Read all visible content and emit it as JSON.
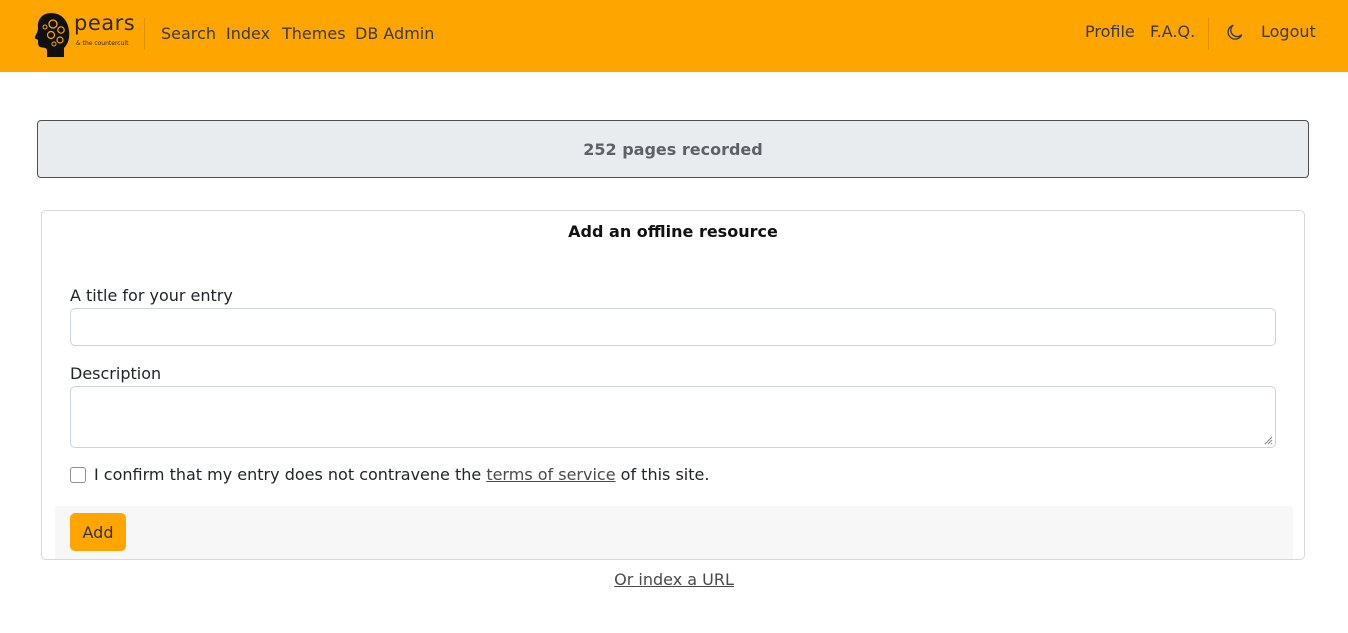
{
  "brand": {
    "name": "pears",
    "tagline": "& the countercult",
    "logo_icon": "head-with-gears-icon",
    "color": "#ffa500"
  },
  "nav": {
    "left": [
      {
        "label": "Search"
      },
      {
        "label": "Index"
      },
      {
        "label": "Themes"
      },
      {
        "label": "DB Admin"
      }
    ],
    "right": {
      "profile": "Profile",
      "faq": "F.A.Q.",
      "theme_icon": "moon-icon",
      "logout": "Logout"
    }
  },
  "stats": {
    "pages_recorded": "252 pages recorded"
  },
  "form": {
    "title": "Add an offline resource",
    "title_label": "A title for your entry",
    "title_value": "",
    "description_label": "Description",
    "description_value": "",
    "confirm_prefix": "I confirm that my entry does not contravene the",
    "confirm_link": "terms of service",
    "confirm_suffix": "of this site.",
    "confirm_checked": false,
    "submit_label": "Add"
  },
  "alt_link": "Or index a URL"
}
